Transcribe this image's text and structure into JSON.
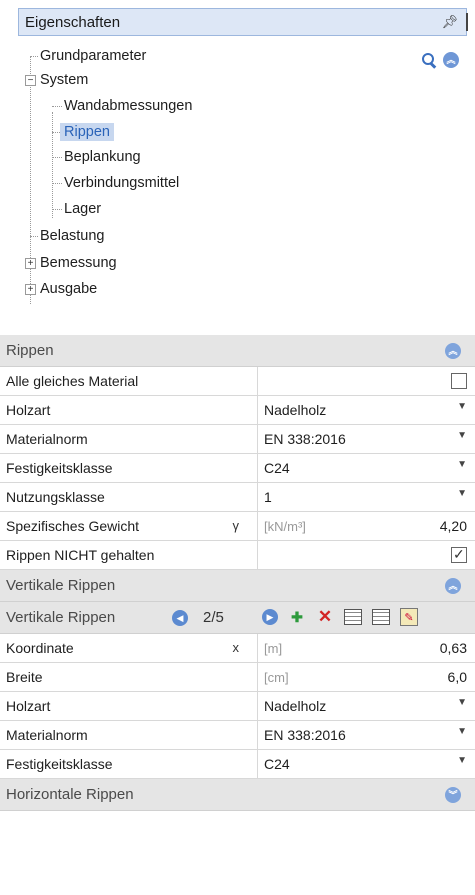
{
  "panel": {
    "title": "Eigenschaften",
    "pin_glyph": "ꟸ",
    "icons": {
      "pin": "pin-icon",
      "search": "search-icon",
      "collapse": "collapse-up-icon"
    }
  },
  "tree": {
    "items": [
      {
        "label": "Grundparameter"
      },
      {
        "label": "System",
        "expander": "−"
      },
      {
        "label": "Wandabmessungen"
      },
      {
        "label": "Rippen",
        "selected": true
      },
      {
        "label": "Beplankung"
      },
      {
        "label": "Verbindungsmittel"
      },
      {
        "label": "Lager"
      },
      {
        "label": "Belastung"
      },
      {
        "label": "Bemessung",
        "expander": "+"
      },
      {
        "label": "Ausgabe",
        "expander": "+"
      }
    ]
  },
  "grid": {
    "section_rippen": "Rippen",
    "rows1": [
      {
        "label": "Alle gleiches Material",
        "checkbox": false
      },
      {
        "label": "Holzart",
        "value": "Nadelholz"
      },
      {
        "label": "Materialnorm",
        "value": "EN 338:2016"
      },
      {
        "label": "Festigkeitsklasse",
        "value": "C24"
      },
      {
        "label": "Nutzungsklasse",
        "value": "1"
      },
      {
        "label": "Spezifisches Gewicht",
        "symbol": "γ",
        "unit": "[kN/m³]",
        "value": "4,20"
      },
      {
        "label": "Rippen NICHT gehalten",
        "checkbox": true
      }
    ],
    "section_vertikal": "Vertikale Rippen",
    "nav": {
      "label": "Vertikale Rippen",
      "counter": "2/5"
    },
    "rows2": [
      {
        "label": "Koordinate",
        "symbol": "x",
        "unit": "[m]",
        "value": "0,63"
      },
      {
        "label": "Breite",
        "unit": "[cm]",
        "value": "6,0"
      },
      {
        "label": "Holzart",
        "value": "Nadelholz"
      },
      {
        "label": "Materialnorm",
        "value": "EN 338:2016"
      },
      {
        "label": "Festigkeitsklasse",
        "value": "C24"
      }
    ],
    "section_horizontal": "Horizontale Rippen"
  },
  "colors": {
    "accent": "#5c8ad0",
    "selection": "#c7d7ef",
    "section_bg": "#e5e5e5"
  }
}
